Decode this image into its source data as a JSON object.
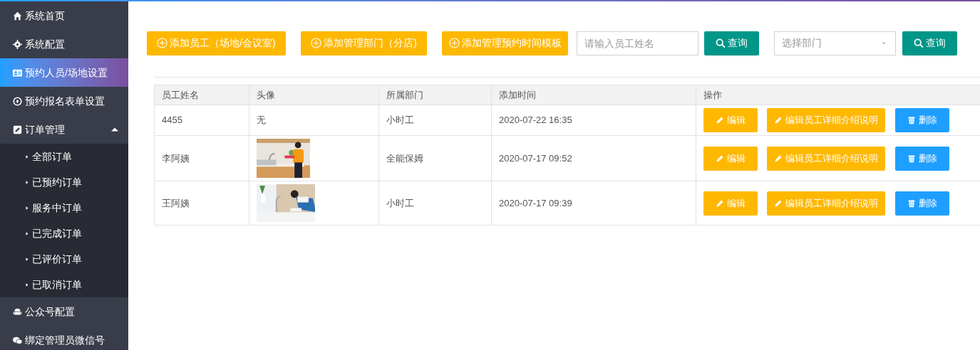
{
  "sidebar": {
    "items": [
      {
        "label": "系统首页",
        "kind": "item",
        "selected": false
      },
      {
        "label": "系统配置",
        "kind": "item",
        "selected": false
      },
      {
        "label": "预约人员/场地设置",
        "kind": "item",
        "selected": true
      },
      {
        "label": "预约报名表单设置",
        "kind": "item",
        "selected": false
      },
      {
        "label": "订单管理",
        "kind": "group",
        "selected": false,
        "expanded": true,
        "children": [
          {
            "label": "全部订单",
            "selected": false
          },
          {
            "label": "已预约订单",
            "selected": false
          },
          {
            "label": "服务中订单",
            "selected": false
          },
          {
            "label": "已完成订单",
            "selected": false
          },
          {
            "label": "已评价订单",
            "selected": false
          },
          {
            "label": "已取消订单",
            "selected": false
          }
        ]
      },
      {
        "label": "公众号配置",
        "kind": "item",
        "selected": false
      },
      {
        "label": "绑定管理员微信号",
        "kind": "item",
        "selected": false
      }
    ]
  },
  "toolbar": {
    "buttons": [
      "添加员工（场地/会议室)",
      "添加管理部门（分店)",
      "添加管理预约时间模板"
    ],
    "name_search": {
      "placeholder": "请输入员工姓名",
      "button": "查询"
    },
    "department_select": {
      "placeholder": "选择部门",
      "button": "查询"
    }
  },
  "table": {
    "columns": [
      "员工姓名",
      "头像",
      "所属部门",
      "添加时间",
      "操作"
    ],
    "rows": [
      {
        "name": "4455",
        "avatar": {
          "kind": "text",
          "text": "无"
        },
        "department": "小时工",
        "added": "2020-07-22 16:35",
        "actions": [
          {
            "kind": "edit",
            "label": "编辑"
          },
          {
            "kind": "edit",
            "label": "编辑员工详细介绍说明"
          },
          {
            "kind": "delete",
            "label": "删除"
          }
        ]
      },
      {
        "name": "李阿姨",
        "department": "全能保姆",
        "added": "2020-07-17 09:52",
        "actions": [
          {
            "kind": "edit",
            "label": "编辑"
          },
          {
            "kind": "edit",
            "label": "编辑员工详细介绍说明"
          },
          {
            "kind": "delete",
            "label": "删除"
          }
        ]
      },
      {
        "name": "王阿姨",
        "department": "小时工",
        "added": "2020-07-17 09:39",
        "actions": [
          {
            "kind": "edit",
            "label": "编辑"
          },
          {
            "kind": "edit",
            "label": "编辑员工详细介绍说明"
          },
          {
            "kind": "delete",
            "label": "删除"
          }
        ]
      }
    ]
  }
}
